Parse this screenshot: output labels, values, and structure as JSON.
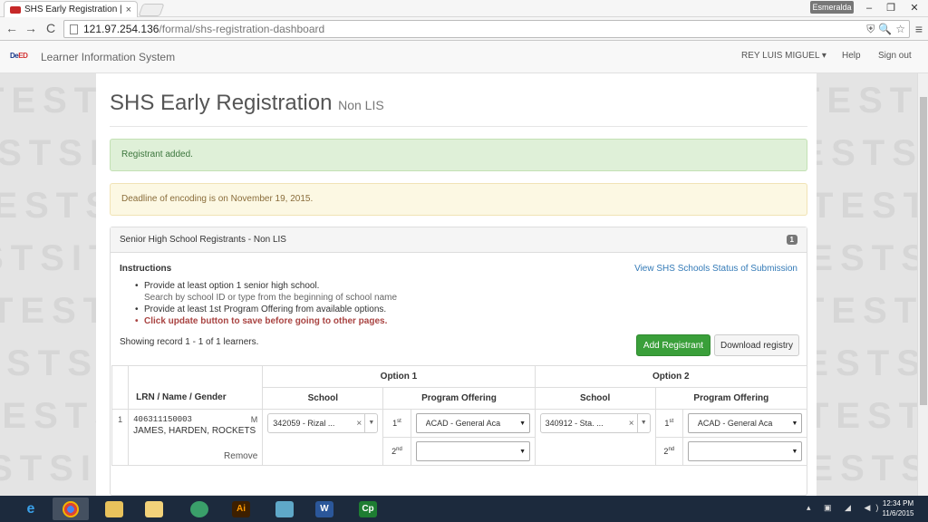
{
  "browser": {
    "tab_title": "SHS Early Registration | Le",
    "tab_close": "×",
    "profile_name": "Esmeralda",
    "window_controls": {
      "minimize": "–",
      "maximize": "❐",
      "close": "✕"
    },
    "nav": {
      "back": "←",
      "forward": "→",
      "reload": "C",
      "menu": "≡"
    },
    "url_host": "121.97.254.136",
    "url_path": "/formal/shs-registration-dashboard",
    "omni_icons": [
      "⛨",
      "🔍",
      "☆"
    ]
  },
  "app": {
    "logo": {
      "part1": "De",
      "part2": "ED"
    },
    "brand": "Learner Information System",
    "nav": {
      "user": "REY LUIS MIGUEL ▾",
      "help": "Help",
      "signout": "Sign out"
    }
  },
  "watermark": "TESTSITE",
  "page": {
    "title": "SHS Early Registration",
    "subtitle": "Non LIS",
    "alert_success": "Registrant added.",
    "alert_warning": "Deadline of encoding is on November 19, 2015."
  },
  "panel": {
    "heading": "Senior High School Registrants - Non LIS",
    "badge": "1",
    "instructions_title": "Instructions",
    "view_link": "View SHS Schools Status of Submission",
    "instructions": {
      "i1": "Provide at least option 1 senior high school.",
      "i1_sub": "Search by school ID or type from the beginning of school name",
      "i2": "Provide at least 1st Program Offering from available options.",
      "i3": "Click update button to save before going to other pages."
    },
    "showing": "Showing record 1 - 1 of 1 learners.",
    "add_button": "Add Registrant",
    "download_button": "Download registry"
  },
  "table": {
    "option1": "Option 1",
    "option2": "Option 2",
    "lrn_header": "LRN / Name / Gender",
    "school_header": "School",
    "program_header": "Program Offering",
    "rows": [
      {
        "num": "1",
        "lrn": "406311150003",
        "gender": "M",
        "name": "JAMES, HARDEN, ROCKETS",
        "remove": "Remove",
        "school1": "342059 - Rizal ...",
        "school2": "340912 - Sta. ...",
        "prog1_1st": "ACAD - General Aca",
        "prog1_2nd": "",
        "prog2_1st": "ACAD - General Aca",
        "prog2_2nd": ""
      }
    ],
    "ord1": "1",
    "ord1_sup": "st",
    "ord2": "2",
    "ord2_sup": "nd",
    "clear": "×",
    "arrow": "▼"
  },
  "taskbar": {
    "apps": [
      "IE",
      "Chrome",
      "Folder",
      "Explorer",
      "Atom",
      "Illustrator",
      "App",
      "Word",
      "Captivate"
    ],
    "ai_label": "Ai",
    "word_label": "W",
    "cp_label": "Cp",
    "tray": "▴ ▣ ◢ ◀)",
    "time": "12:34 PM",
    "date": "11/6/2015"
  },
  "colors": {
    "success_bg": "#dff0d8",
    "warning_bg": "#fcf8e3",
    "add_button": "#3a9f3a",
    "link": "#337ab7",
    "warn_text": "#a94442"
  }
}
